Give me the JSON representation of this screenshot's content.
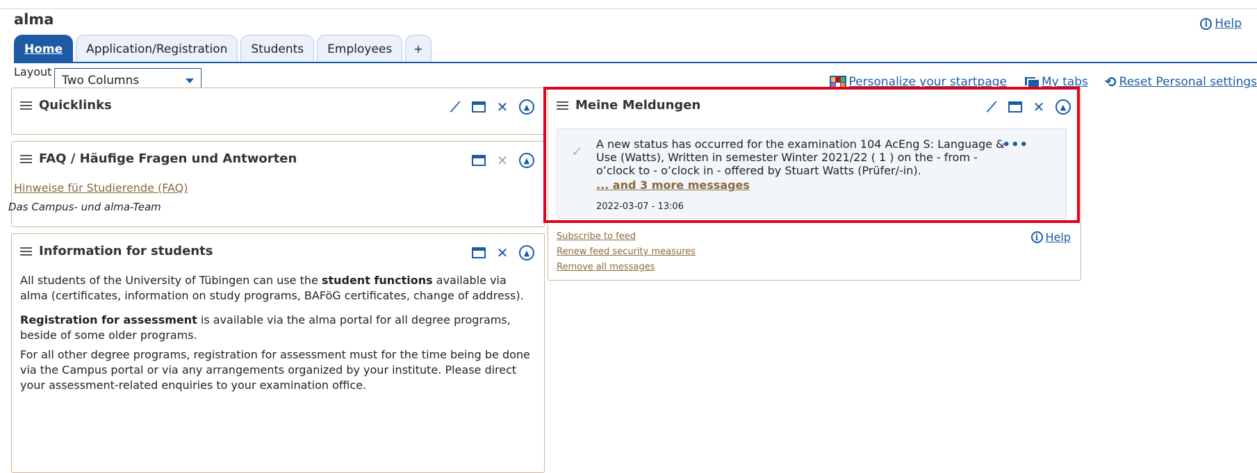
{
  "app": {
    "title": "alma",
    "help_label": "Help"
  },
  "tabs": [
    {
      "label": "Home"
    },
    {
      "label": "Application/Registration"
    },
    {
      "label": "Students"
    },
    {
      "label": "Employees"
    },
    {
      "label": "+"
    }
  ],
  "layout": {
    "label": "Layout",
    "selected": "Two Columns"
  },
  "toplinks": {
    "personalize": "Personalize your startpage",
    "mytabs": "My tabs",
    "reset": "Reset Personal settings"
  },
  "quicklinks": {
    "title": "Quicklinks"
  },
  "faq": {
    "title": "FAQ / Häufige Fragen und Antworten",
    "link": "Hinweise für Studierende (FAQ)",
    "team": "Das Campus- und alma-Team"
  },
  "info": {
    "title": "Information for students",
    "p1_before": "All students of the University of Tübingen can use the ",
    "p1_bold": "student functions",
    "p1_after": " available via alma (certificates, information on study programs, BAFöG certificates, change of address).",
    "p2_bold": "Registration for assessment",
    "p2_after": " is available via the alma portal for all degree programs, beside of some older programs.",
    "p3": "For all other degree programs, registration for assessment must for the time being be done via the Campus portal or via any arrangements organized by your institute. Please direct your assessment-related enquiries to your examination office."
  },
  "messages": {
    "title": "Meine Meldungen",
    "text": "A new status has occurred for the examination 104 AcEng S: Language & Use (Watts), Written in semester Winter 2021/22 ( 1 ) on the - from - o’clock to - o’clock in - offered by Stuart Watts (Prüfer/-in).",
    "more": "... and 3 more messages",
    "date": "2022-03-07 - 13:06",
    "subscribe": "Subscribe to feed",
    "renew": "Renew feed security measures",
    "remove": "Remove all messages",
    "help": "Help"
  },
  "colors": {
    "primary": "#1c5aa6",
    "highlight": "#e3001b",
    "panel_border": "#c9b79a",
    "link_brown": "#8a6a3b"
  }
}
